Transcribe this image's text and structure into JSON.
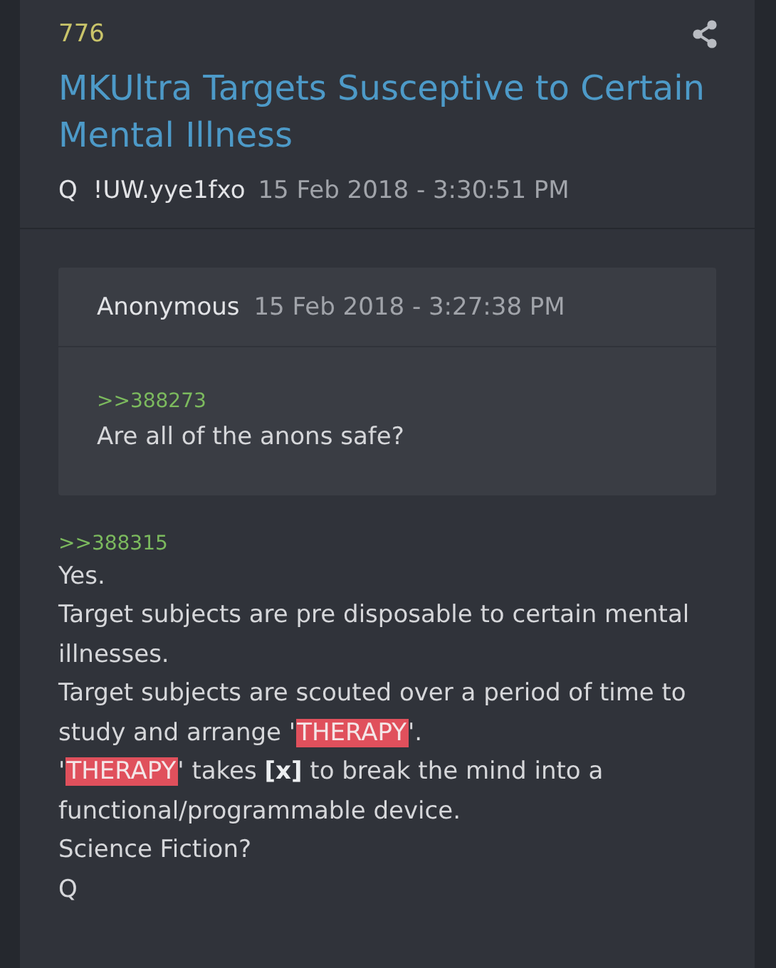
{
  "post": {
    "number": "776",
    "title": "MKUltra Targets Susceptive to Certain Mental Illness",
    "author": "Q",
    "tripcode": "!UW.yye1fxo",
    "timestamp": "15 Feb 2018 - 3:30:51 PM"
  },
  "quote": {
    "author": "Anonymous",
    "timestamp": "15 Feb 2018 - 3:27:38 PM",
    "reply_link": ">>388273",
    "text": "Are all of the anons safe?"
  },
  "body": {
    "reply_link": ">>388315",
    "lines": [
      [
        {
          "kind": "text",
          "text": "Yes."
        }
      ],
      [
        {
          "kind": "text",
          "text": "Target subjects are pre disposable to certain mental illnesses."
        }
      ],
      [
        {
          "kind": "text",
          "text": "Target subjects are scouted over a period of time to study and arrange '"
        },
        {
          "kind": "highlight",
          "text": "THERAPY"
        },
        {
          "kind": "text",
          "text": "'."
        }
      ],
      [
        {
          "kind": "text",
          "text": "'"
        },
        {
          "kind": "highlight",
          "text": "THERAPY"
        },
        {
          "kind": "text",
          "text": "' takes "
        },
        {
          "kind": "bold",
          "text": "[x]"
        },
        {
          "kind": "text",
          "text": " to break the mind into a functional/programmable device."
        }
      ],
      [
        {
          "kind": "text",
          "text": "Science Fiction?"
        }
      ],
      [
        {
          "kind": "text",
          "text": "Q"
        }
      ]
    ]
  }
}
